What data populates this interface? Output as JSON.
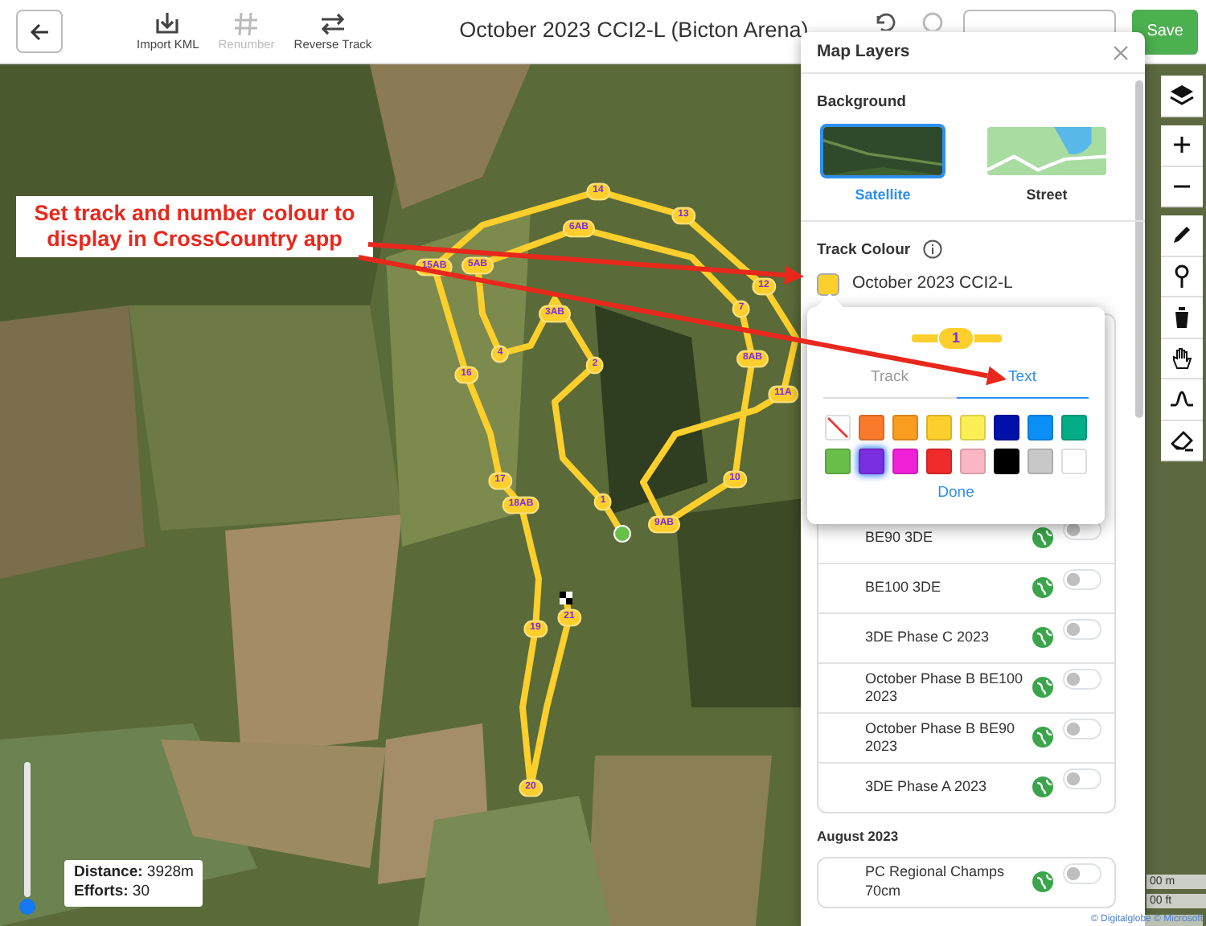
{
  "toolbar": {
    "tools": [
      {
        "kind": "import",
        "label": "Import KML",
        "disabled": false
      },
      {
        "kind": "renumber",
        "label": "Renumber",
        "disabled": true
      },
      {
        "kind": "reverse",
        "label": "Reverse Track",
        "disabled": false
      }
    ],
    "title": "October 2023 CCI2-L (Bicton Arena)",
    "save": "Save"
  },
  "map": {
    "annotation": "Set track and number colour to display in CrossCountry app",
    "fence_markers": [
      {
        "label": "14"
      },
      {
        "label": "13"
      },
      {
        "label": "6AB"
      },
      {
        "label": "15AB"
      },
      {
        "label": "5AB"
      },
      {
        "label": "3AB"
      },
      {
        "label": "12"
      },
      {
        "label": "7"
      },
      {
        "label": "4"
      },
      {
        "label": "2"
      },
      {
        "label": "8AB"
      },
      {
        "label": "11A"
      },
      {
        "label": "16"
      },
      {
        "label": "10"
      },
      {
        "label": "17"
      },
      {
        "label": "18AB"
      },
      {
        "label": "1"
      },
      {
        "label": "9AB"
      },
      {
        "label": "21"
      },
      {
        "label": "19"
      },
      {
        "label": "20"
      }
    ],
    "zoom_slider": {
      "level": 0
    },
    "stats": {
      "distance_label": "Distance:",
      "distance": "3928m",
      "efforts_label": "Efforts:",
      "efforts": "30"
    },
    "scale": [
      "00 m",
      "00 ft"
    ],
    "attribution": "© Digitalglobe © Microsoft"
  },
  "map_layers": {
    "title": "Map Layers",
    "background_heading": "Background",
    "backgrounds": [
      {
        "kind": "satellite",
        "label": "Satellite",
        "selected": true
      },
      {
        "kind": "street",
        "label": "Street",
        "selected": false
      }
    ],
    "track_colour_heading": "Track Colour",
    "track": {
      "name": "October 2023 CCI2-L",
      "color": "#fccf2c"
    },
    "course_groups": [
      {
        "courses": [
          {
            "name": "BE90 3DE",
            "on": false
          },
          {
            "name": "BE100 3DE",
            "on": false
          },
          {
            "name": "3DE Phase C 2023",
            "on": false
          },
          {
            "name": "October Phase B BE100 2023",
            "on": false
          },
          {
            "name": "October Phase B BE90 2023",
            "on": false
          },
          {
            "name": "3DE Phase A 2023",
            "on": false
          }
        ]
      },
      {
        "heading": "August 2023",
        "courses": [
          {
            "name": "PC Regional Champs 70cm",
            "on": false
          }
        ]
      }
    ]
  },
  "colour_popover": {
    "marker_label": "1",
    "tabs": [
      {
        "label": "Track",
        "selected": false
      },
      {
        "label": "Text",
        "selected": true
      }
    ],
    "swatches": [
      {
        "kind": "none",
        "selected": false
      },
      {
        "kind": "colour",
        "color": "#f97a2b",
        "selected": false
      },
      {
        "kind": "colour",
        "color": "#f99c20",
        "selected": false
      },
      {
        "kind": "colour",
        "color": "#fccf2c",
        "selected": false
      },
      {
        "kind": "colour",
        "color": "#fcee55",
        "selected": false
      },
      {
        "kind": "colour",
        "color": "#0011aa",
        "selected": false
      },
      {
        "kind": "colour",
        "color": "#0a8ff6",
        "selected": false
      },
      {
        "kind": "colour",
        "color": "#03ae86",
        "selected": false
      },
      {
        "kind": "colour",
        "color": "#6abf4b",
        "selected": false
      },
      {
        "kind": "colour",
        "color": "#7b2de0",
        "selected": true
      },
      {
        "kind": "colour",
        "color": "#f020d9",
        "selected": false
      },
      {
        "kind": "colour",
        "color": "#f02b2b",
        "selected": false
      },
      {
        "kind": "colour",
        "color": "#fbb6c4",
        "selected": false
      },
      {
        "kind": "colour",
        "color": "#000000",
        "selected": false
      },
      {
        "kind": "colour",
        "color": "#c8c8c8",
        "selected": false
      },
      {
        "kind": "colour",
        "color": "#ffffff",
        "selected": false
      }
    ],
    "done": "Done"
  }
}
